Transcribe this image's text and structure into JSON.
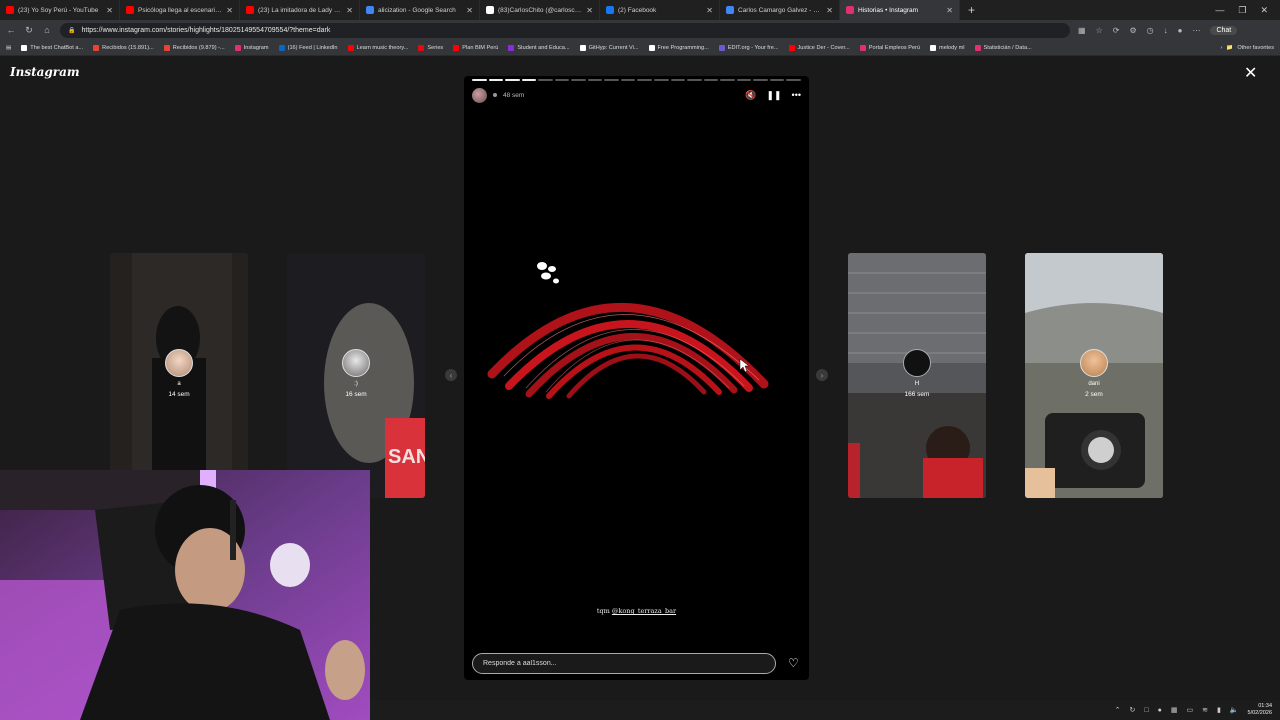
{
  "browser": {
    "tabs": [
      {
        "title": "(23) Yo Soy Perú - YouTube",
        "color": "#ff0000"
      },
      {
        "title": "Psicóloga llega al escenario imitan",
        "color": "#ff0000"
      },
      {
        "title": "(23) La imitadora de Lady Gaga se",
        "color": "#ff0000"
      },
      {
        "title": "alicization - Google Search",
        "color": "#4285f4"
      },
      {
        "title": "(83)CarlosChito (@carloscamargo",
        "color": "#ffffff"
      },
      {
        "title": "(2) Facebook",
        "color": "#1877f2"
      },
      {
        "title": "Carlos Camargo Galvez - Google",
        "color": "#4285f4"
      },
      {
        "title": "Historias • Instagram",
        "color": "#e1306c",
        "active": true
      }
    ],
    "url": "https://www.instagram.com/stories/highlights/18025149554709554/?theme=dark",
    "chat_label": "Chat",
    "bookmarks": [
      {
        "label": "The best ChatBot a...",
        "color": "#ffffff"
      },
      {
        "label": "Recibidos (15.891)...",
        "color": "#ea4335"
      },
      {
        "label": "Recibidos (9.879) -...",
        "color": "#ea4335"
      },
      {
        "label": "Instagram",
        "color": "#e1306c"
      },
      {
        "label": "(16) Feed | LinkedIn",
        "color": "#0a66c2"
      },
      {
        "label": "Learn music theory...",
        "color": "#ff0000"
      },
      {
        "label": "Series",
        "color": "#e50914"
      },
      {
        "label": "Plan BIM Perú",
        "color": "#ff0000"
      },
      {
        "label": "Student and Educa...",
        "color": "#8a2be2"
      },
      {
        "label": "GitHyp: Current Vi...",
        "color": "#ffffff"
      },
      {
        "label": "Free Programming...",
        "color": "#ffffff"
      },
      {
        "label": "EDIT.org - Your fre...",
        "color": "#6a5acd"
      },
      {
        "label": "Justice Der - Cover...",
        "color": "#ff0000"
      },
      {
        "label": "Portal Empleos Perú",
        "color": "#e1306c"
      },
      {
        "label": "melody ml",
        "color": "#ffffff"
      },
      {
        "label": "Statisticián / Data...",
        "color": "#e1306c"
      }
    ],
    "other_favorites": "Other favorites"
  },
  "instagram": {
    "logo": "Instagram",
    "side_cards": [
      {
        "user": "a",
        "age": "14 sem",
        "bg": "#262321"
      },
      {
        "user": ":)",
        "age": "16 sem",
        "bg": "#1e1e22"
      },
      {
        "user": "H",
        "age": "166 sem",
        "bg": "#5a5a5e"
      },
      {
        "user": "dani",
        "age": "2 sem",
        "bg": "#9ba2a8"
      }
    ],
    "story": {
      "time": "48 sem",
      "caption_prefix": "tqm ",
      "caption_mention": "@kong_terraza_bar",
      "progress_total": 20,
      "progress_done": 4
    },
    "reply_placeholder": "Responde a aal1sson..."
  },
  "taskbar": {
    "time": "01:34",
    "date": "5/02/2026"
  }
}
